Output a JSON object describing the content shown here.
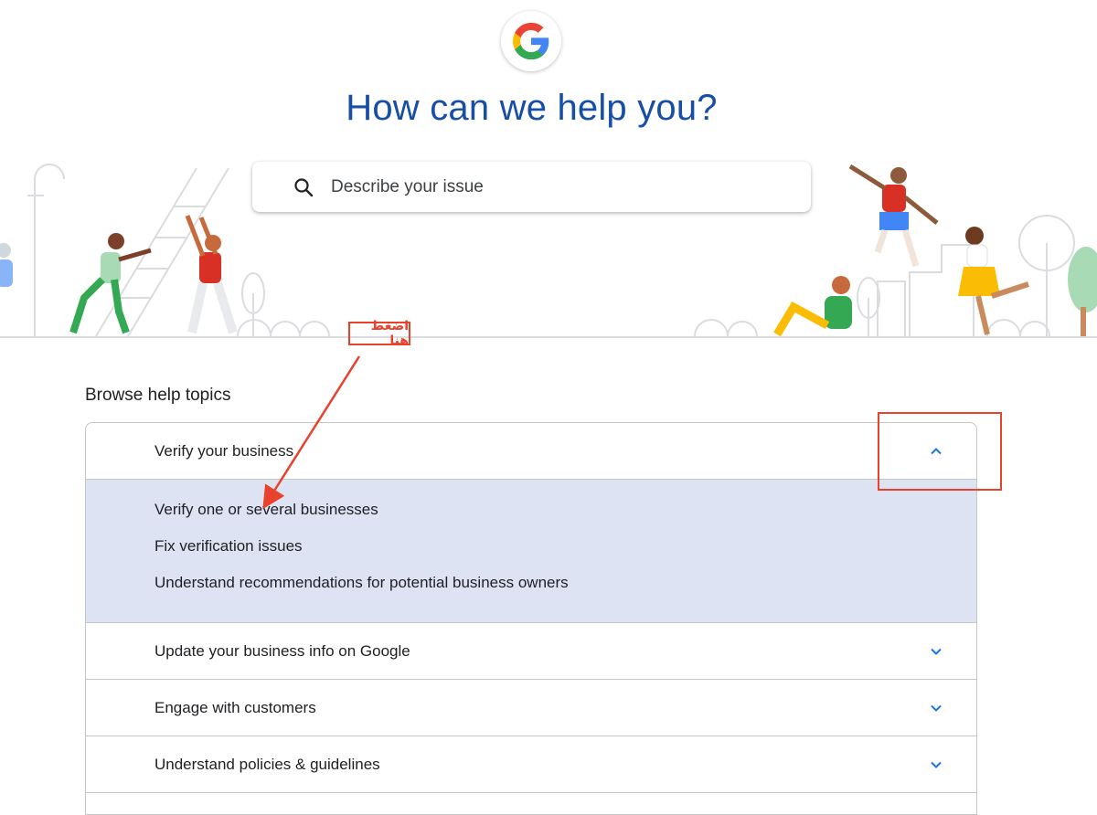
{
  "hero": {
    "title": "How can we help you?"
  },
  "search": {
    "placeholder": "Describe your issue"
  },
  "annotation": {
    "label": "اضغط هنا"
  },
  "browse": {
    "title": "Browse help topics",
    "topics": [
      {
        "label": "Verify your business",
        "expanded": true,
        "items": [
          "Verify one or several businesses",
          "Fix verification issues",
          "Understand recommendations for potential business owners"
        ]
      },
      {
        "label": "Update your business info on Google",
        "expanded": false
      },
      {
        "label": "Engage with customers",
        "expanded": false
      },
      {
        "label": "Understand policies & guidelines",
        "expanded": false
      }
    ]
  },
  "colors": {
    "title": "#174ea6",
    "accent": "#1a73e8",
    "panel": "#dde3f2",
    "annotation": "#e8412c"
  }
}
